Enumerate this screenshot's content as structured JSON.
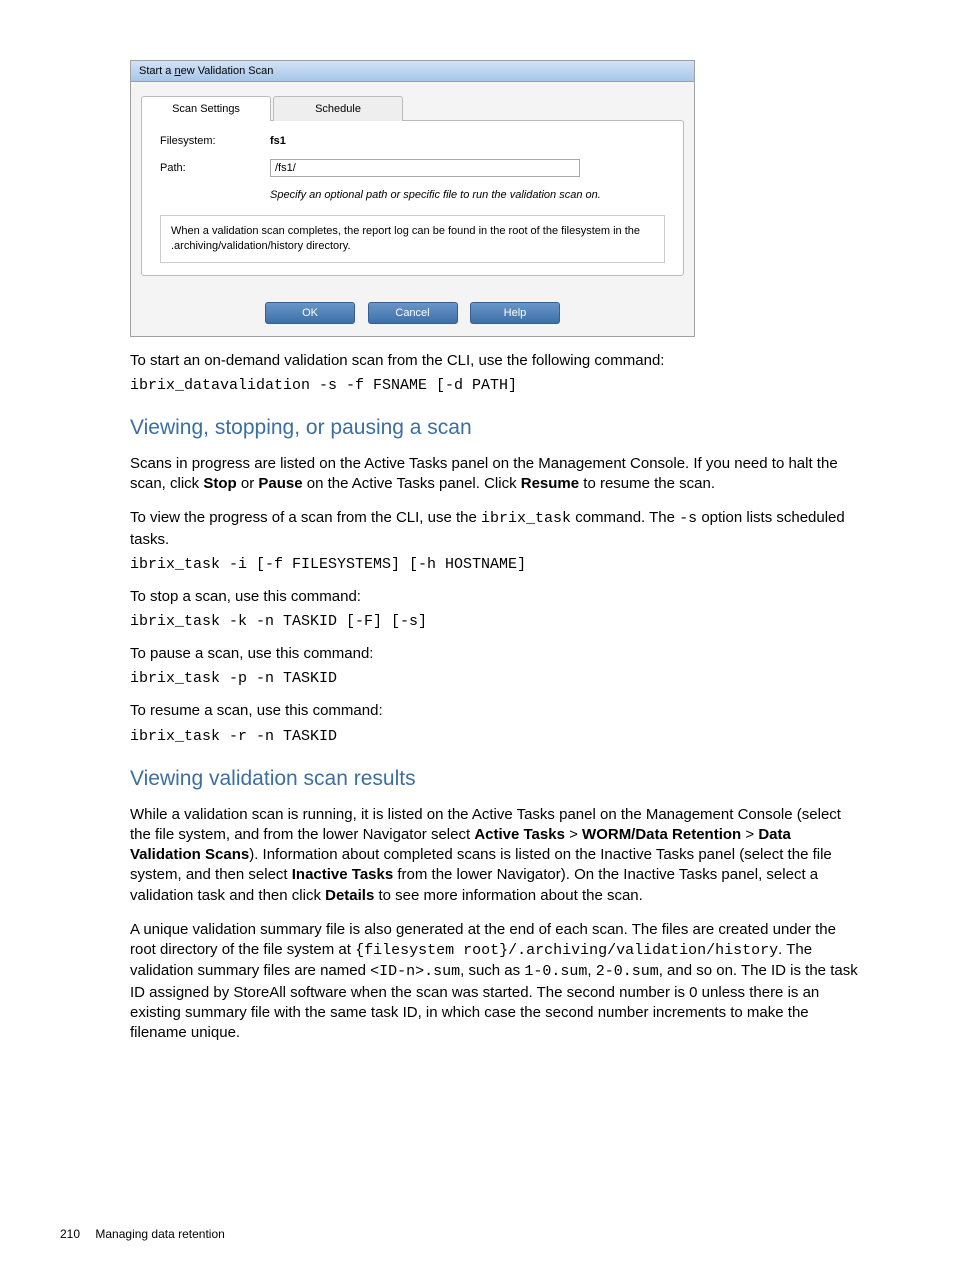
{
  "dialog": {
    "title_prefix": "Start a ",
    "title_underlined": "n",
    "title_suffix": "ew Validation Scan",
    "tabs": {
      "scan": "Scan Settings",
      "schedule": "Schedule"
    },
    "form": {
      "fs_label": "Filesystem:",
      "fs_value": "fs1",
      "path_label": "Path:",
      "path_value": "/fs1/",
      "path_help": "Specify an optional path or specific file to run the validation scan on.",
      "info": "When a validation scan completes, the report log can be found in the root of the filesystem in the .archiving/validation/history directory."
    },
    "buttons": {
      "ok": "OK",
      "cancel": "Cancel",
      "help": "Help"
    }
  },
  "body": {
    "p1": "To start an on-demand validation scan from the CLI, use the following command:",
    "c1": "ibrix_datavalidation -s -f FSNAME [-d PATH]",
    "h1": "Viewing, stopping, or pausing a scan",
    "p2a": "Scans in progress are listed on the Active Tasks panel on the Management Console. If you need to halt the scan, click ",
    "p2b": "Stop",
    "p2c": " or ",
    "p2d": "Pause",
    "p2e": " on the Active Tasks panel. Click ",
    "p2f": "Resume",
    "p2g": " to resume the scan.",
    "p3a": "To view the progress of a scan from the CLI, use the ",
    "p3b": "ibrix_task",
    "p3c": " command. The ",
    "p3d": "-s",
    "p3e": " option lists scheduled tasks.",
    "c2": "ibrix_task -i [-f FILESYSTEMS] [-h HOSTNAME]",
    "p4": "To stop a scan, use this command:",
    "c3": "ibrix_task -k -n TASKID [-F] [-s]",
    "p5": "To pause a scan, use this command:",
    "c4": "ibrix_task -p -n TASKID",
    "p6": "To resume a scan, use this command:",
    "c5": "ibrix_task -r -n TASKID",
    "h2": "Viewing validation scan results",
    "p7a": "While a validation scan is running, it is listed on the Active Tasks panel on the Management Console (select the file system, and from the lower Navigator select ",
    "p7b": "Active Tasks",
    "p7c": " > ",
    "p7d": "WORM/Data Retention",
    "p7e": " > ",
    "p7f": "Data Validation Scans",
    "p7g": "). Information about completed scans is listed on the Inactive Tasks panel (select the file system, and then select ",
    "p7h": "Inactive Tasks",
    "p7i": " from the lower Navigator). On the Inactive Tasks panel, select a validation task and then click ",
    "p7j": "Details",
    "p7k": " to see more information about the scan.",
    "p8a": "A unique validation summary file is also generated at the end of each scan. The files are created under the root directory of the file system at ",
    "p8b": "{filesystem root}/.archiving/validation/history",
    "p8c": ". The validation summary files are named ",
    "p8d": "<ID-n>.sum",
    "p8e": ", such as ",
    "p8f": "1-0.sum",
    "p8g": ", ",
    "p8h": "2-0.sum",
    "p8i": ", and so on. The ID is the task ID assigned by StoreAll software when the scan was started. The second number is 0 unless there is an existing summary file with the same task ID, in which case the second number increments to make the filename unique."
  },
  "footer": {
    "page": "210",
    "chapter": "Managing data retention"
  }
}
